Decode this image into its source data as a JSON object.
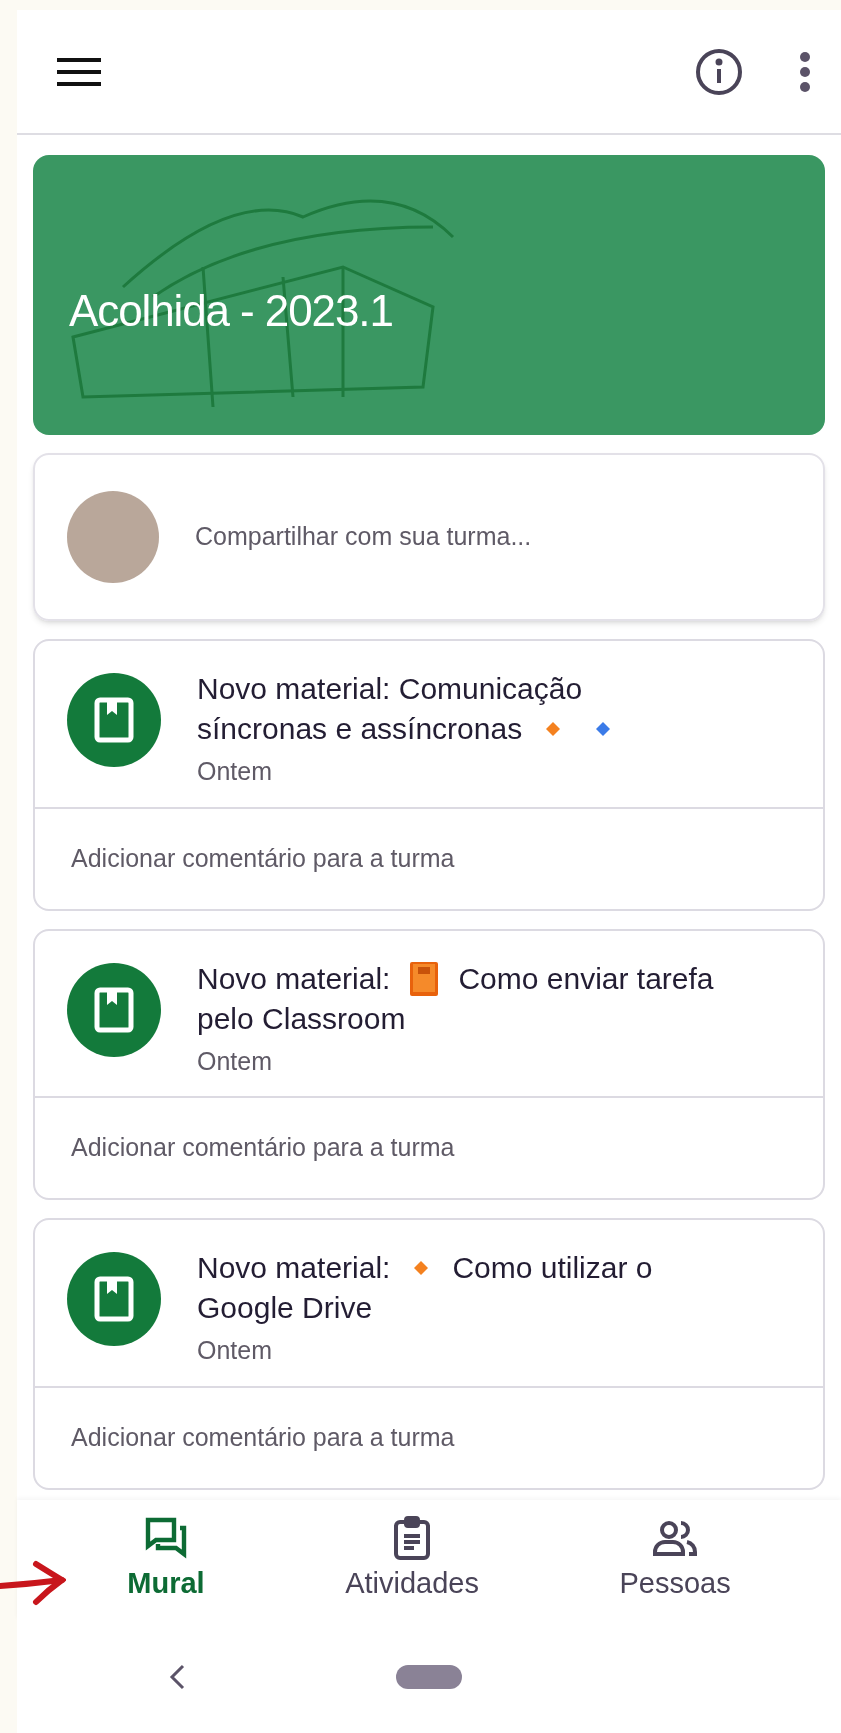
{
  "class": {
    "title": "Acolhida - 2023.1"
  },
  "composer": {
    "placeholder": "Compartilhar com sua turma..."
  },
  "posts": [
    {
      "title_lines": [
        [
          {
            "kind": "text",
            "text": "Novo material: Comunicação"
          }
        ],
        [
          {
            "kind": "text",
            "text": "síncronas e assíncronas"
          },
          {
            "kind": "diamond",
            "color": "#f4811f"
          },
          {
            "kind": "diamond",
            "color": "#3b7be8"
          }
        ]
      ],
      "time": "Ontem",
      "comment": "Adicionar comentário para a turma"
    },
    {
      "title_lines": [
        [
          {
            "kind": "text",
            "text": "Novo material:"
          },
          {
            "kind": "book"
          },
          {
            "kind": "text",
            "text": "Como enviar tarefa"
          }
        ],
        [
          {
            "kind": "text",
            "text": "pelo Classroom"
          }
        ]
      ],
      "time": "Ontem",
      "comment": "Adicionar comentário para a turma"
    },
    {
      "title_lines": [
        [
          {
            "kind": "text",
            "text": "Novo material:"
          },
          {
            "kind": "diamond",
            "color": "#f4811f"
          },
          {
            "kind": "text",
            "text": "Como utilizar o"
          }
        ],
        [
          {
            "kind": "text",
            "text": "Google Drive"
          }
        ]
      ],
      "time": "Ontem",
      "comment": "Adicionar comentário para a turma"
    }
  ],
  "nav": [
    {
      "label": "Mural",
      "kind": "stream",
      "selected": true
    },
    {
      "label": "Atividades",
      "kind": "classwork",
      "selected": false
    },
    {
      "label": "Pessoas",
      "kind": "people",
      "selected": false
    }
  ]
}
